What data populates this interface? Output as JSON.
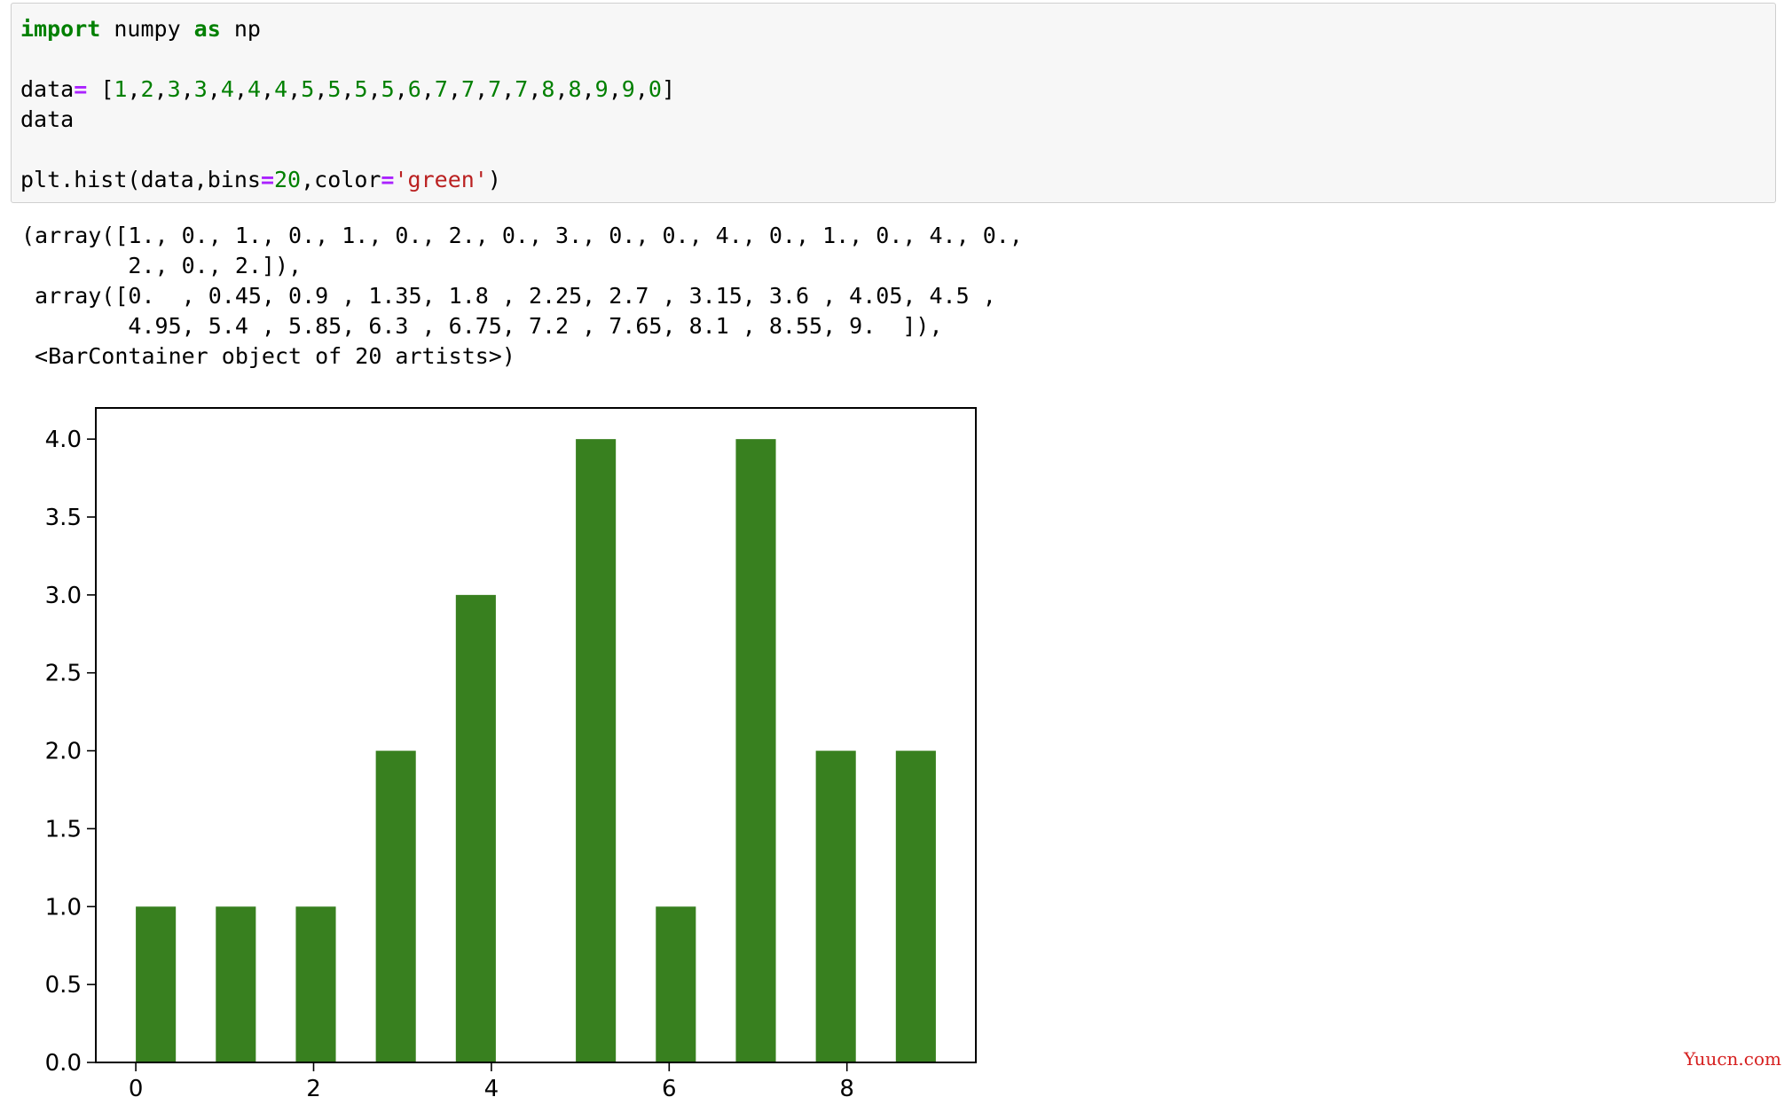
{
  "code_cell": {
    "lines": [
      [
        {
          "t": "import",
          "c": "kw"
        },
        {
          "t": " numpy ",
          "c": ""
        },
        {
          "t": "as",
          "c": "kw"
        },
        {
          "t": " np",
          "c": ""
        }
      ],
      [],
      [
        {
          "t": "data",
          "c": ""
        },
        {
          "t": "=",
          "c": "op"
        },
        {
          "t": " [",
          "c": ""
        },
        {
          "t": "1",
          "c": "num"
        },
        {
          "t": ",",
          "c": ""
        },
        {
          "t": "2",
          "c": "num"
        },
        {
          "t": ",",
          "c": ""
        },
        {
          "t": "3",
          "c": "num"
        },
        {
          "t": ",",
          "c": ""
        },
        {
          "t": "3",
          "c": "num"
        },
        {
          "t": ",",
          "c": ""
        },
        {
          "t": "4",
          "c": "num"
        },
        {
          "t": ",",
          "c": ""
        },
        {
          "t": "4",
          "c": "num"
        },
        {
          "t": ",",
          "c": ""
        },
        {
          "t": "4",
          "c": "num"
        },
        {
          "t": ",",
          "c": ""
        },
        {
          "t": "5",
          "c": "num"
        },
        {
          "t": ",",
          "c": ""
        },
        {
          "t": "5",
          "c": "num"
        },
        {
          "t": ",",
          "c": ""
        },
        {
          "t": "5",
          "c": "num"
        },
        {
          "t": ",",
          "c": ""
        },
        {
          "t": "5",
          "c": "num"
        },
        {
          "t": ",",
          "c": ""
        },
        {
          "t": "6",
          "c": "num"
        },
        {
          "t": ",",
          "c": ""
        },
        {
          "t": "7",
          "c": "num"
        },
        {
          "t": ",",
          "c": ""
        },
        {
          "t": "7",
          "c": "num"
        },
        {
          "t": ",",
          "c": ""
        },
        {
          "t": "7",
          "c": "num"
        },
        {
          "t": ",",
          "c": ""
        },
        {
          "t": "7",
          "c": "num"
        },
        {
          "t": ",",
          "c": ""
        },
        {
          "t": "8",
          "c": "num"
        },
        {
          "t": ",",
          "c": ""
        },
        {
          "t": "8",
          "c": "num"
        },
        {
          "t": ",",
          "c": ""
        },
        {
          "t": "9",
          "c": "num"
        },
        {
          "t": ",",
          "c": ""
        },
        {
          "t": "9",
          "c": "num"
        },
        {
          "t": ",",
          "c": ""
        },
        {
          "t": "0",
          "c": "num"
        },
        {
          "t": "]",
          "c": ""
        }
      ],
      [
        {
          "t": "data",
          "c": ""
        }
      ],
      [],
      [
        {
          "t": "plt.hist(data,bins",
          "c": ""
        },
        {
          "t": "=",
          "c": "op"
        },
        {
          "t": "20",
          "c": "num"
        },
        {
          "t": ",color",
          "c": ""
        },
        {
          "t": "=",
          "c": "op"
        },
        {
          "t": "'green'",
          "c": "str"
        },
        {
          "t": ")",
          "c": ""
        }
      ]
    ]
  },
  "output": {
    "lines": [
      "(array([1., 0., 1., 0., 1., 0., 2., 0., 3., 0., 0., 4., 0., 1., 0., 4., 0.,",
      "        2., 0., 2.]),",
      " array([0.  , 0.45, 0.9 , 1.35, 1.8 , 2.25, 2.7 , 3.15, 3.6 , 4.05, 4.5 ,",
      "        4.95, 5.4 , 5.85, 6.3 , 6.75, 7.2 , 7.65, 8.1 , 8.55, 9.  ]),",
      " <BarContainer object of 20 artists>)"
    ]
  },
  "chart_data": {
    "type": "bar",
    "bar_color": "#38801f",
    "bin_edges": [
      0,
      0.45,
      0.9,
      1.35,
      1.8,
      2.25,
      2.7,
      3.15,
      3.6,
      4.05,
      4.5,
      4.95,
      5.4,
      5.85,
      6.3,
      6.75,
      7.2,
      7.65,
      8.1,
      8.55,
      9.0
    ],
    "counts": [
      1,
      0,
      1,
      0,
      1,
      0,
      2,
      0,
      3,
      0,
      0,
      4,
      0,
      1,
      0,
      4,
      0,
      2,
      0,
      2
    ],
    "xlim": [
      -0.45,
      9.45
    ],
    "ylim": [
      0,
      4.2
    ],
    "xticks": [
      0,
      2,
      4,
      6,
      8
    ],
    "yticks": [
      0.0,
      0.5,
      1.0,
      1.5,
      2.0,
      2.5,
      3.0,
      3.5,
      4.0
    ],
    "xtick_labels": [
      "0",
      "2",
      "4",
      "6",
      "8"
    ],
    "ytick_labels": [
      "0.0",
      "0.5",
      "1.0",
      "1.5",
      "2.0",
      "2.5",
      "3.0",
      "3.5",
      "4.0"
    ],
    "grid": false
  },
  "watermark": "Yuucn.com"
}
